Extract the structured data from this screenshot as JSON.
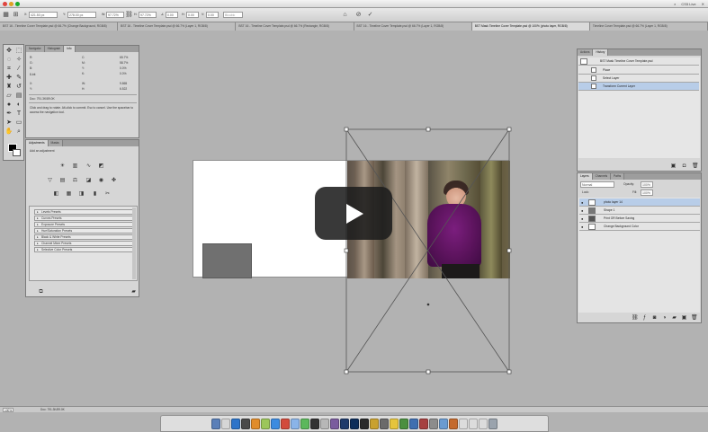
{
  "options_bar": {
    "fields": [
      {
        "name": "x-position",
        "label": "X:",
        "value": "421.50 px"
      },
      {
        "name": "y-position",
        "label": "Y:",
        "value": "278.00 px"
      },
      {
        "name": "width",
        "label": "W:",
        "value": "97.72%"
      },
      {
        "name": "height",
        "label": "H:",
        "value": "97.72%"
      },
      {
        "name": "rotation",
        "label": "∠",
        "value": "0.00"
      },
      {
        "name": "h-skew",
        "label": "H:",
        "value": "0.00"
      },
      {
        "name": "v-skew",
        "label": "V:",
        "value": "0.00"
      },
      {
        "name": "interpolation",
        "label": "",
        "value": "Bicubic"
      }
    ],
    "icons": [
      "warp-icon",
      "cancel-transform-icon",
      "commit-transform-icon"
    ]
  },
  "window_top_right": {
    "label": "CS5 Live"
  },
  "tabs": [
    {
      "label": "BST 16 - Timeline Cover Template.psd @ 66.7% (Change Background, RGB/8)"
    },
    {
      "label": "BST 16 - Timeline Cover Template.psd @ 66.7% (Layer 1, RGB/8)"
    },
    {
      "label": "BST 16 - Timeline Cover Template.psd @ 66.7% (Rectangle, RGB/8)"
    },
    {
      "label": "BST 16 - Timeline Cover Template.psd @ 66.7% (Layer 1, RGB/8)"
    },
    {
      "label": "BST Mask Timeline Cover Template.psd @ 100% (photo layer, RGB/8)"
    },
    {
      "label": "Timeline Cover Template.psd @ 66.7% (Layer 1, RGB/8)"
    }
  ],
  "info_panel": {
    "tabs": [
      "Navigator",
      "Histogram",
      "Info"
    ],
    "rows": [
      {
        "left_label": "R:",
        "left_value": "",
        "right_label": "C:",
        "right_value": "65.7%"
      },
      {
        "left_label": "G:",
        "left_value": "",
        "right_label": "M:",
        "right_value": "58.7%"
      },
      {
        "left_label": "B:",
        "left_value": "",
        "right_label": "Y:",
        "right_value": "0.0%"
      },
      {
        "left_label": "8-bit",
        "left_value": "",
        "right_label": "K:",
        "right_value": "0.0%"
      },
      {
        "left_label": "X:",
        "left_value": "",
        "right_label": "W:",
        "right_value": "9.865"
      },
      {
        "left_label": "Y:",
        "left_value": "",
        "right_label": "H:",
        "right_value": "6.522"
      }
    ],
    "doc_size": "Doc: 791.3K/89.0K",
    "help_text": [
      "Click and drag to rotate. Alt-click to commit. Esc to cancel. Use the spacebar to access the navigation tool."
    ]
  },
  "adjustments_panel": {
    "tabs": [
      "Adjustments",
      "Masks"
    ],
    "heading": "Add an adjustment",
    "presets": [
      {
        "label": "Levels Presets"
      },
      {
        "label": "Curves Presets"
      },
      {
        "label": "Exposure Presets"
      },
      {
        "label": "Hue/Saturation Presets"
      },
      {
        "label": "Black & White Presets"
      },
      {
        "label": "Channel Mixer Presets"
      },
      {
        "label": "Selective Color Presets"
      }
    ]
  },
  "actions_panel": {
    "tabs": [
      "Actions",
      "History"
    ],
    "rows": [
      {
        "label": "BST Mask Timeline Cover Template.psd",
        "selected": false
      },
      {
        "label": "Place",
        "selected": false
      },
      {
        "label": "Select Layer",
        "selected": false
      },
      {
        "label": "Transform Current Layer",
        "selected": true
      }
    ]
  },
  "layers_panel": {
    "tabs": [
      "Layers",
      "Channels",
      "Paths"
    ],
    "blend_mode": "Normal",
    "opacity_label": "Opacity:",
    "opacity": "100%",
    "fill_label": "Fill:",
    "fill": "100%",
    "lock_label": "Lock:",
    "layers": [
      {
        "name": "photo layer 14",
        "selected": true
      },
      {
        "name": "Shape 1",
        "selected": false
      },
      {
        "name": "Print OR Before Saving",
        "selected": false
      },
      {
        "name": "Change Background Color",
        "selected": false
      }
    ]
  },
  "status_bar": {
    "zoom": "100%",
    "doc": "Doc: 791.3K/89.0K"
  },
  "canvas": {
    "photo_description_colors": {
      "coat": "#6a1a6e",
      "bark": "#7a6b5a"
    }
  },
  "video_overlay": {
    "icon": "play-icon"
  },
  "colors": {
    "accent_selected": "#b8cde8",
    "panel_bg": "#d6d6d6",
    "workspace_bg": "#b2b2b2"
  }
}
